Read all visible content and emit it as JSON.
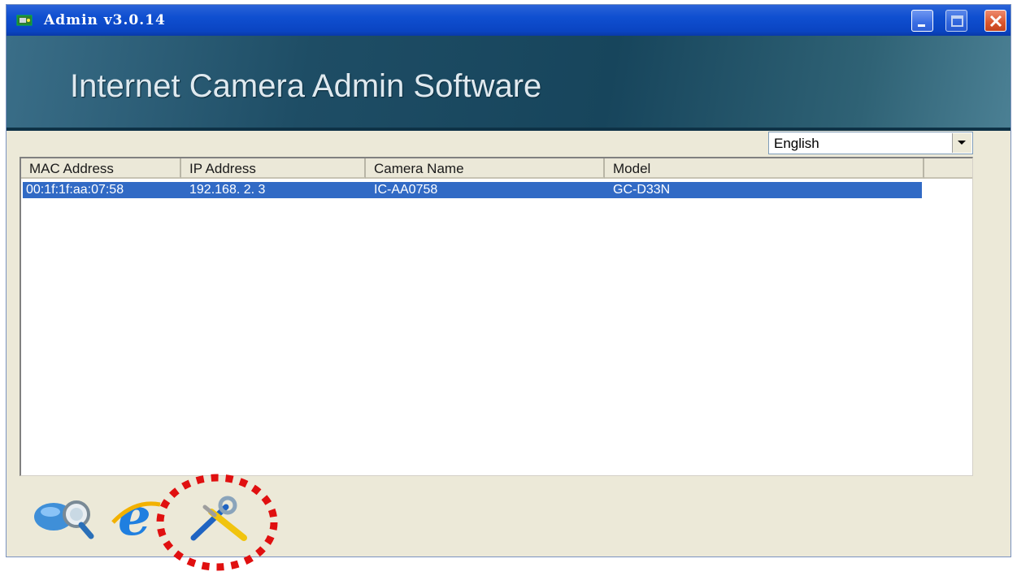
{
  "window": {
    "title": "Admin v3.0.14",
    "banner_title": "Internet Camera Admin Software",
    "controls": [
      "minimize-icon",
      "maximize-icon",
      "close-icon"
    ]
  },
  "language": {
    "selected": "English"
  },
  "device_list": {
    "columns": [
      "MAC Address",
      "IP Address",
      "Camera Name",
      "Model"
    ],
    "rows": [
      {
        "mac": "00:1f:1f:aa:07:58",
        "ip": "192.168. 2. 3",
        "name": "IC-AA0758",
        "model": "GC-D33N",
        "selected": true
      }
    ]
  },
  "toolbar": {
    "icons": [
      "search-camera-icon",
      "internet-explorer-icon",
      "setup-tools-icon"
    ],
    "highlighted": "setup-tools-icon"
  },
  "colors": {
    "titlebar": "#0a44c2",
    "banner": "#1e4d65",
    "selection": "#316ac5",
    "highlight_ring": "#e01010"
  }
}
